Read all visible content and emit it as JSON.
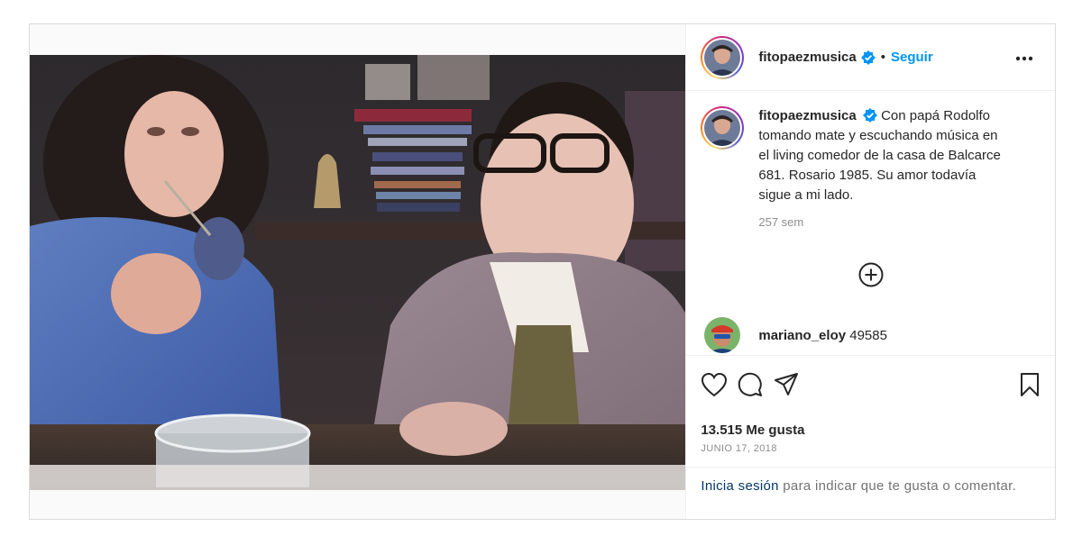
{
  "post": {
    "username": "fitopaezmusica",
    "separator": "•",
    "follow_label": "Seguir",
    "more_icon": "more-horizontal-icon",
    "caption": "Con papá Rodolfo tomando mate y escuchando música en el living comedor de la casa de Balcarce 681. Rosario 1985. Su amor todavía sigue a mi lado.",
    "caption_age": "257 sem",
    "load_more_icon": "plus-circle-icon",
    "comments": [
      {
        "username": "mariano_eloy",
        "text": "49585"
      }
    ],
    "likes_text": "13.515 Me gusta",
    "date_text": "JUNIO 17, 2018",
    "login_link": "Inicia sesión",
    "login_rest": "para indicar que te gusta o comentar.",
    "accent_color": "#0095f6"
  }
}
